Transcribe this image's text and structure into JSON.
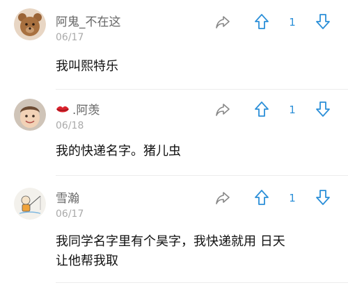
{
  "colors": {
    "accent": "#2b8fd8",
    "share": "#888888",
    "badge": "#d9232d"
  },
  "comments": [
    {
      "username": "阿鬼_不在这",
      "date": "06/17",
      "text": "我叫熙特乐",
      "votes": "1",
      "avatar_icon": "bear-avatar"
    },
    {
      "username": ".阿羡",
      "badge_icon": "red-lips-icon",
      "date": "06/18",
      "text": "我的快递名字。猪儿虫",
      "votes": "1",
      "avatar_icon": "child-photo-avatar"
    },
    {
      "username": "雪瀚",
      "date": "06/17",
      "text_line1": "我同学名字里有个昊字，我快递就用 日天",
      "text_line2": "让他帮我取",
      "votes": "1",
      "avatar_icon": "cartoon-fishing-avatar"
    }
  ]
}
